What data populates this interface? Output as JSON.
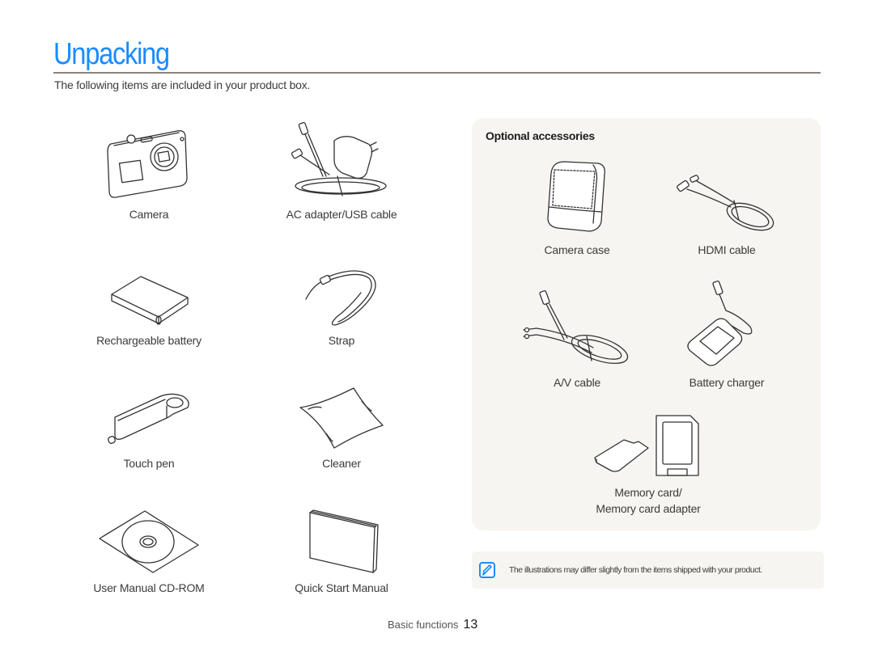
{
  "page": {
    "title": "Unpacking",
    "intro": "The following items are included in your product box."
  },
  "included_items": [
    {
      "label": "Camera",
      "icon": "camera-icon"
    },
    {
      "label": "AC adapter/USB cable",
      "icon": "ac-adapter-icon"
    },
    {
      "label": "Rechargeable battery",
      "icon": "battery-icon"
    },
    {
      "label": "Strap",
      "icon": "strap-icon"
    },
    {
      "label": "Touch pen",
      "icon": "touch-pen-icon"
    },
    {
      "label": "Cleaner",
      "icon": "cleaner-icon"
    },
    {
      "label": "User Manual CD-ROM",
      "icon": "cd-rom-icon"
    },
    {
      "label": "Quick Start Manual",
      "icon": "manual-booklet-icon"
    }
  ],
  "optional": {
    "heading": "Optional accessories",
    "items": [
      {
        "label": "Camera case",
        "icon": "camera-case-icon"
      },
      {
        "label": "HDMI cable",
        "icon": "hdmi-cable-icon"
      },
      {
        "label": "A/V cable",
        "icon": "av-cable-icon"
      },
      {
        "label": "Battery charger",
        "icon": "battery-charger-icon"
      },
      {
        "label_line1": "Memory card/",
        "label_line2": "Memory card adapter",
        "icon": "memory-card-icon"
      }
    ]
  },
  "note": {
    "icon": "note-pencil-icon",
    "text": "The illustrations may differ slightly from the items shipped with your product."
  },
  "footer": {
    "section": "Basic functions",
    "page_number": "13"
  },
  "colors": {
    "accent": "#1a8cff",
    "panel_bg": "#f7f5f1",
    "rule": "#8a807c"
  }
}
